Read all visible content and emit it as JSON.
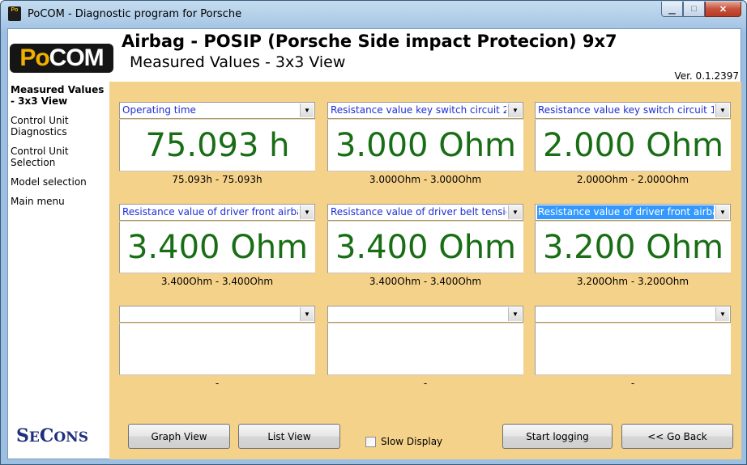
{
  "window": {
    "title": "PoCOM - Diagnostic program for Porsche",
    "icon_text": "Po",
    "controls": {
      "minimize": "▁",
      "maximize": "□",
      "close": "✕"
    }
  },
  "logo": {
    "part1": "Po",
    "part2": "COM"
  },
  "header": {
    "title": "Airbag - POSIP (Porsche Side impact Protecion) 9x7",
    "subtitle": "Measured Values - 3x3 View",
    "version": "Ver. 0.1.2397"
  },
  "sidebar": {
    "items": [
      {
        "label": "Measured Values - 3x3 View",
        "active": true
      },
      {
        "label": "Control Unit Diagnostics",
        "active": false
      },
      {
        "label": "Control Unit Selection",
        "active": false
      },
      {
        "label": "Model selection",
        "active": false
      },
      {
        "label": "Main menu",
        "active": false
      }
    ],
    "brand": {
      "first": "S",
      "rest": "E",
      "tail": "C",
      "end": "ONS"
    }
  },
  "gauges": [
    {
      "label": "Operating time",
      "value": "75.093 h",
      "range": "75.093h - 75.093h",
      "selected": false
    },
    {
      "label": "Resistance value key switch circuit 2",
      "value": "3.000 Ohm",
      "range": "3.000Ohm - 3.000Ohm",
      "selected": false
    },
    {
      "label": "Resistance value key switch circuit 1",
      "value": "2.000 Ohm",
      "range": "2.000Ohm - 2.000Ohm",
      "selected": false
    },
    {
      "label": "Resistance value of driver front airbag st",
      "value": "3.400 Ohm",
      "range": "3.400Ohm - 3.400Ohm",
      "selected": false
    },
    {
      "label": "Resistance value of driver belt tensioner",
      "value": "3.400 Ohm",
      "range": "3.400Ohm - 3.400Ohm",
      "selected": false
    },
    {
      "label": "Resistance value of driver front airbag st",
      "value": "3.200 Ohm",
      "range": "3.200Ohm - 3.200Ohm",
      "selected": true
    },
    {
      "label": "",
      "value": "",
      "range": "-",
      "selected": false
    },
    {
      "label": "",
      "value": "",
      "range": "-",
      "selected": false
    },
    {
      "label": "",
      "value": "",
      "range": "-",
      "selected": false
    }
  ],
  "buttons": {
    "graph_view": "Graph View",
    "list_view": "List View",
    "slow_display": "Slow Display",
    "start_logging": "Start logging",
    "go_back": "<< Go Back"
  },
  "colors": {
    "panel_bg": "#f5d28a",
    "value_text": "#196e15",
    "combo_text": "#1f2ed1",
    "selection": "#3399ff"
  }
}
